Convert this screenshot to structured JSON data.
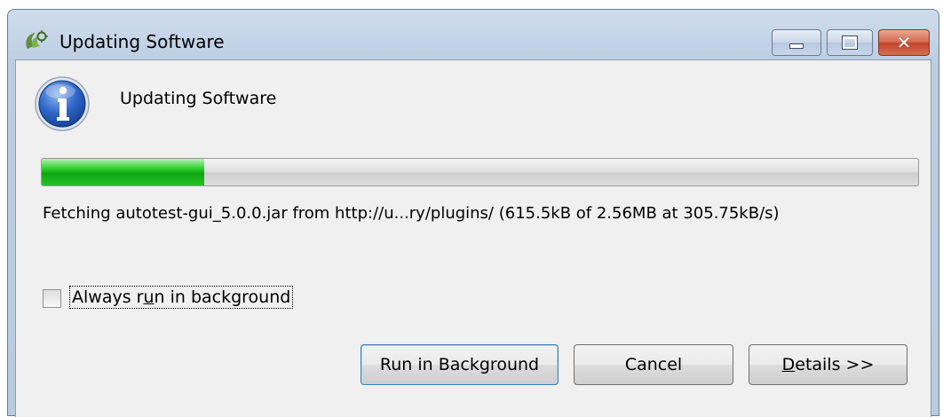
{
  "window": {
    "title": "Updating Software",
    "app_icon": "eclipse-software-updates-icon",
    "controls": {
      "minimize_icon": "minimize-icon",
      "maximize_icon": "maximize-icon",
      "close_icon": "close-icon",
      "close_glyph": "✕"
    }
  },
  "dialog": {
    "icon": "info-icon",
    "heading": "Updating Software",
    "progress_percent": 18.5,
    "status": "Fetching autotest-gui_5.0.0.jar from http://u...ry/plugins/ (615.5kB of 2.56MB at 305.75kB/s)",
    "checkbox": {
      "label": "Always run in background",
      "checked": false
    },
    "buttons": {
      "run_in_background": "Run in Background",
      "cancel": "Cancel",
      "details": "Details >>"
    }
  },
  "colors": {
    "progress_green": "#1bbd1b",
    "titlebar_blue": "#c3d3e6",
    "client_background": "#f0f0f0",
    "close_red": "#c2422a"
  }
}
